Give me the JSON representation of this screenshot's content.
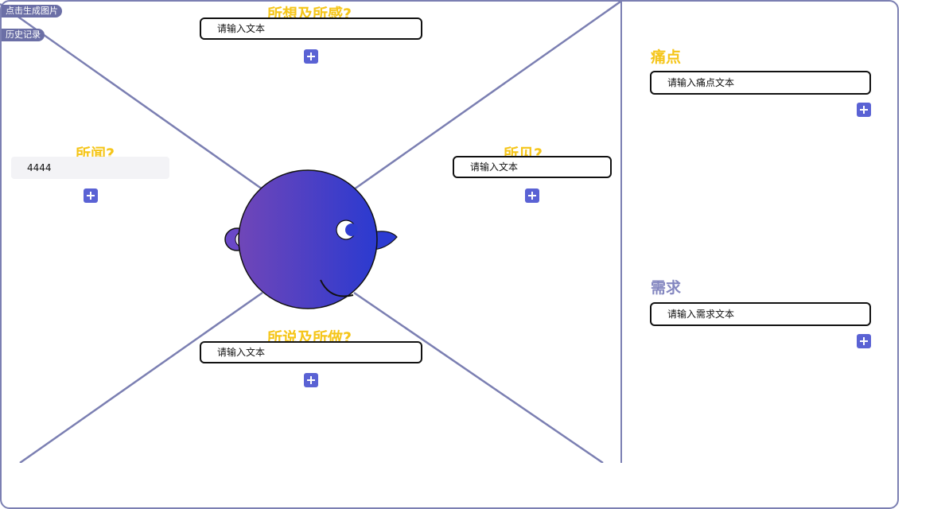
{
  "toolbar": {
    "generate_image": "点击生成图片",
    "history": "历史记录"
  },
  "map": {
    "think_feel": {
      "title": "所想及所感?",
      "placeholder": "请输入文本",
      "value": ""
    },
    "hear": {
      "title": "所闻?",
      "placeholder": "请输入文本",
      "value": "4444"
    },
    "see": {
      "title": "所见?",
      "placeholder": "请输入文本",
      "value": ""
    },
    "say_do": {
      "title": "所说及所做?",
      "placeholder": "请输入文本",
      "value": ""
    }
  },
  "side": {
    "pain": {
      "title": "痛点",
      "placeholder": "请输入痛点文本"
    },
    "need": {
      "title": "需求",
      "placeholder": "请输入需求文本"
    }
  },
  "colors": {
    "accent": "#5a62d4",
    "heading_yellow": "#f5c518",
    "heading_purple": "#8487c0",
    "line": "#7b7fb2"
  }
}
